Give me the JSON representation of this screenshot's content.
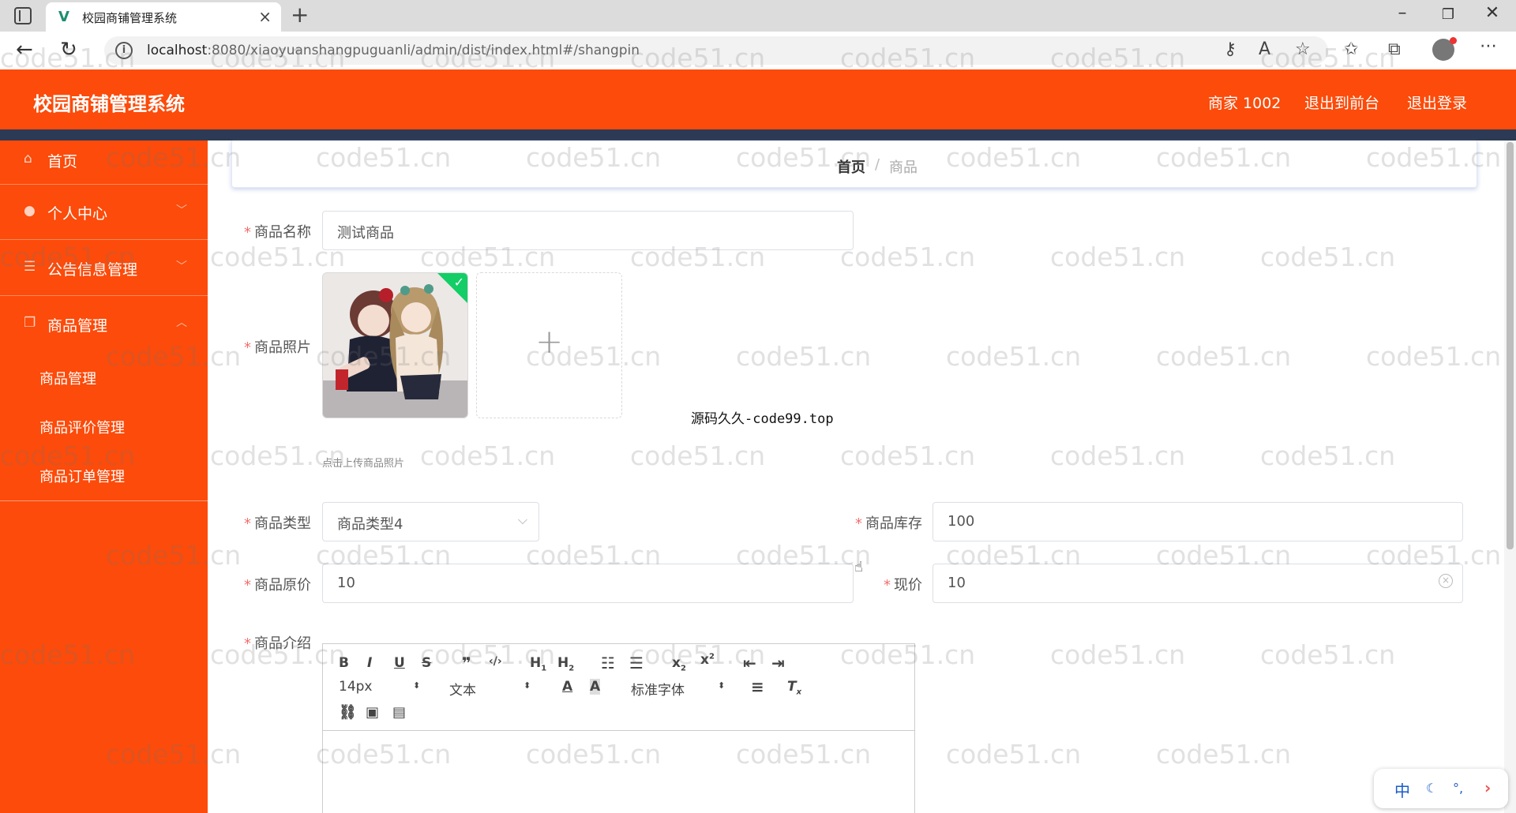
{
  "browser": {
    "tab_title": "校园商铺管理系统",
    "tab_logo": "V",
    "url_host": "localhost",
    "url_rest": ":8080/xiaoyuanshangpuguanli/admin/dist/index.html#/shangpin"
  },
  "header": {
    "title": "校园商铺管理系统",
    "user": "商家 1002",
    "to_front": "退出到前台",
    "logout": "退出登录"
  },
  "sidebar": {
    "items": [
      {
        "label": "首页",
        "icon": "home-icon"
      },
      {
        "label": "个人中心",
        "icon": "user-icon"
      },
      {
        "label": "公告信息管理",
        "icon": "list-icon"
      },
      {
        "label": "商品管理",
        "icon": "copy-icon"
      }
    ],
    "sub_items": [
      "商品管理",
      "商品评价管理",
      "商品订单管理"
    ]
  },
  "breadcrumb": {
    "home": "首页",
    "sep": "/",
    "current": "商品"
  },
  "form": {
    "name_label": "商品名称",
    "name_value": "测试商品",
    "photo_label": "商品照片",
    "upload_hint": "点击上传商品照片",
    "type_label": "商品类型",
    "type_value": "商品类型4",
    "stock_label": "商品库存",
    "stock_value": "100",
    "orig_price_label": "商品原价",
    "orig_price_value": "10",
    "price_label": "现价",
    "price_value": "10",
    "intro_label": "商品介绍",
    "required_mark": "*"
  },
  "editor": {
    "font_size": "14px",
    "header_select": "文本",
    "font_family": "标准字体"
  },
  "overlay_text": "源码久久-code99.top",
  "watermark": "code51.cn",
  "ime": {
    "mode": "中"
  },
  "colors": {
    "accent": "#fc4b0a",
    "strip": "#2d3a55",
    "required": "#f56c6c"
  }
}
